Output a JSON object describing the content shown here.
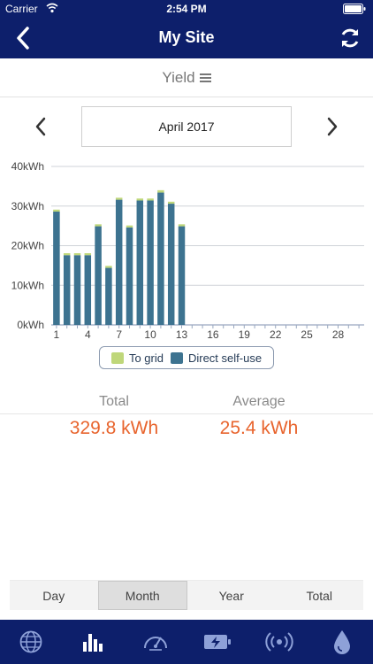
{
  "status_bar": {
    "carrier": "Carrier",
    "time": "2:54 PM"
  },
  "nav": {
    "title": "My Site",
    "back_icon": "chevron-left-icon",
    "refresh_icon": "refresh-icon"
  },
  "yield_selector": {
    "label": "Yield",
    "icon": "menu-icon"
  },
  "period": {
    "label": "April 2017",
    "prev_icon": "chevron-left-icon",
    "next_icon": "chevron-right-icon"
  },
  "chart_data": {
    "type": "bar",
    "stacked": true,
    "x": [
      1,
      2,
      3,
      4,
      5,
      6,
      7,
      8,
      9,
      10,
      11,
      12,
      13,
      14,
      15,
      16,
      17,
      18,
      19,
      20,
      21,
      22,
      23,
      24,
      25,
      26,
      27,
      28,
      29,
      30
    ],
    "x_tick_labels": [
      "1",
      "4",
      "7",
      "10",
      "13",
      "16",
      "19",
      "22",
      "25",
      "28"
    ],
    "x_ticks": [
      1,
      4,
      7,
      10,
      13,
      16,
      19,
      22,
      25,
      28
    ],
    "y_tick_labels": [
      "0kWh",
      "10kWh",
      "20kWh",
      "30kWh",
      "40kWh"
    ],
    "y_ticks": [
      0,
      10,
      20,
      30,
      40
    ],
    "ylim": [
      0,
      40
    ],
    "series": [
      {
        "name": "Direct self-use",
        "color": "#3d7390",
        "values": [
          28.6,
          17.6,
          17.6,
          17.6,
          24.9,
          14.4,
          31.6,
          24.6,
          31.4,
          31.4,
          33.4,
          30.6,
          24.9,
          null,
          null,
          null,
          null,
          null,
          null,
          null,
          null,
          null,
          null,
          null,
          null,
          null,
          null,
          null,
          null,
          null
        ]
      },
      {
        "name": "To grid",
        "color": "#bfd77a",
        "values": [
          0.5,
          0.5,
          0.5,
          0.5,
          0.5,
          0.5,
          0.5,
          0.5,
          0.5,
          0.5,
          0.6,
          0.5,
          0.5,
          null,
          null,
          null,
          null,
          null,
          null,
          null,
          null,
          null,
          null,
          null,
          null,
          null,
          null,
          null,
          null,
          null
        ]
      }
    ],
    "grid": true,
    "legend_position": "bottom"
  },
  "legend": {
    "to_grid": "To grid",
    "direct_self_use": "Direct self-use"
  },
  "stats": {
    "total_label": "Total",
    "total_value": "329.8 kWh",
    "average_label": "Average",
    "average_value": "25.4 kWh"
  },
  "period_tabs": {
    "items": [
      "Day",
      "Month",
      "Year",
      "Total"
    ],
    "active_index": 1
  },
  "tab_bar": {
    "items": [
      "globe-icon",
      "bar-chart-icon",
      "gauge-icon",
      "battery-charging-icon",
      "broadcast-icon",
      "water-drop-icon"
    ],
    "active_index": 1
  },
  "colors": {
    "header_bg": "#0d1f6b",
    "accent_value": "#e8642d",
    "self_use": "#3d7390",
    "to_grid": "#bfd77a"
  }
}
